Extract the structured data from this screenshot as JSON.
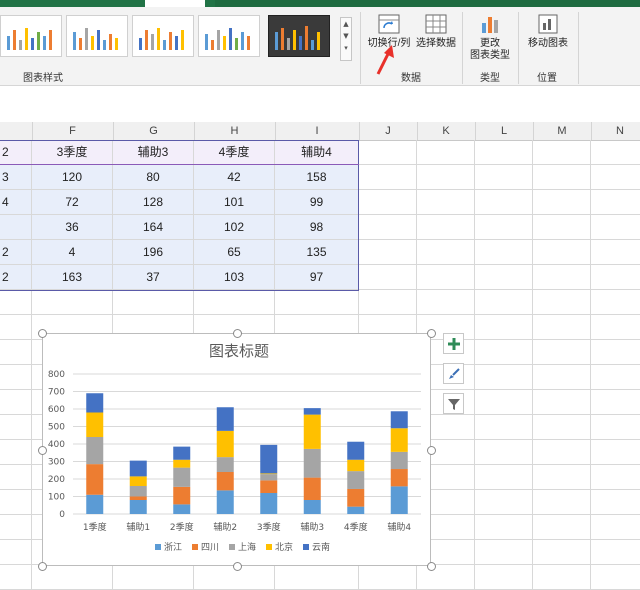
{
  "ribbon": {
    "chart_styles_label": "图表样式",
    "data_group_label": "数据",
    "type_group_label": "类型",
    "position_group_label": "位置",
    "switch_row_col_label": "切换行/列",
    "select_data_label": "选择数据",
    "change_type_label_1": "更改",
    "change_type_label_2": "图表类型",
    "move_chart_label": "移动图表"
  },
  "columns": [
    "F",
    "G",
    "H",
    "I",
    "J",
    "K",
    "L",
    "M",
    "N"
  ],
  "table": {
    "headers": [
      "2",
      "3季度",
      "辅助3",
      "4季度",
      "辅助4"
    ],
    "rows": [
      [
        "3",
        "120",
        "80",
        "42",
        "158"
      ],
      [
        "4",
        "72",
        "128",
        "101",
        "99"
      ],
      [
        "",
        "36",
        "164",
        "102",
        "98"
      ],
      [
        "2",
        "4",
        "196",
        "65",
        "135"
      ],
      [
        "2",
        "163",
        "37",
        "103",
        "97"
      ]
    ]
  },
  "chart_data": {
    "type": "bar",
    "stacked": true,
    "title": "图表标题",
    "categories": [
      "1季度",
      "辅助1",
      "2季度",
      "辅助2",
      "3季度",
      "辅助3",
      "4季度",
      "辅助4"
    ],
    "series": [
      {
        "name": "浙江",
        "color": "#5b9bd5",
        "values": [
          110,
          80,
          55,
          135,
          120,
          80,
          42,
          158
        ]
      },
      {
        "name": "四川",
        "color": "#ed7d31",
        "values": [
          175,
          20,
          100,
          105,
          72,
          128,
          101,
          99
        ]
      },
      {
        "name": "上海",
        "color": "#a5a5a5",
        "values": [
          155,
          60,
          110,
          85,
          36,
          164,
          102,
          98
        ]
      },
      {
        "name": "北京",
        "color": "#ffc000",
        "values": [
          140,
          55,
          45,
          150,
          4,
          196,
          65,
          135
        ]
      },
      {
        "name": "云南",
        "color": "#4472c4",
        "values": [
          110,
          90,
          75,
          135,
          163,
          37,
          103,
          97
        ]
      }
    ],
    "yticks": [
      0,
      100,
      200,
      300,
      400,
      500,
      600,
      700,
      800
    ],
    "ylim": [
      0,
      800
    ],
    "legend_position": "bottom",
    "grid": true
  },
  "side_buttons": {
    "add_element_icon": "plus-icon",
    "style_icon": "paintbrush-icon",
    "filter_icon": "filter-icon"
  }
}
